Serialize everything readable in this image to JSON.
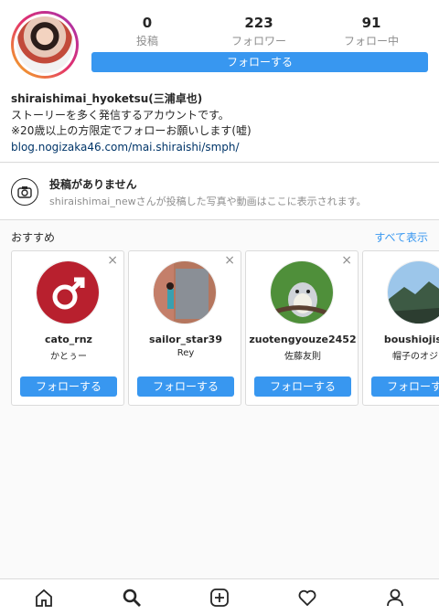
{
  "profile": {
    "stats": [
      {
        "num": "0",
        "label": "投稿"
      },
      {
        "num": "223",
        "label": "フォロワー"
      },
      {
        "num": "91",
        "label": "フォロー中"
      }
    ],
    "follow_label": "フォローする",
    "name": "shiraishimai_hyoketsu(三浦卓也)",
    "bio_line1": "ストーリーを多く発信するアカウントです。",
    "bio_line2": "※20歳以上の方限定でフォローお願いします(嘘)",
    "link": "blog.nogizaka46.com/mai.shiraishi/smph/"
  },
  "no_posts": {
    "title": "投稿がありません",
    "subtitle": "shiraishimai_newさんが投稿した写真や動画はここに表示されます。"
  },
  "suggestions": {
    "heading": "おすすめ",
    "see_all": "すべて表示",
    "close_glyph": "×",
    "items": [
      {
        "username": "cato_rnz",
        "name": "かとぅー",
        "follow": "フォローする"
      },
      {
        "username": "sailor_star39",
        "name": "Rey",
        "follow": "フォローする"
      },
      {
        "username": "zuotengyouze2452",
        "name": "佐藤友則",
        "follow": "フォローする"
      },
      {
        "username": "boushiojisan",
        "name": "帽子のオジさ",
        "follow": "フォローする"
      }
    ]
  },
  "colors": {
    "accent": "#3897f0",
    "link": "#003569"
  },
  "nav": [
    "home-icon",
    "search-icon",
    "add-icon",
    "heart-icon",
    "profile-icon"
  ]
}
